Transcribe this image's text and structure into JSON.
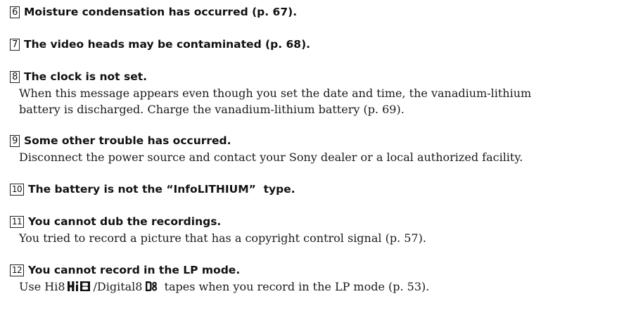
{
  "messages": [
    {
      "number": "6",
      "title": "Moisture condensation has occurred (p. 67).",
      "body": []
    },
    {
      "number": "7",
      "title": "The video heads may be contaminated (p. 68).",
      "body": []
    },
    {
      "number": "8",
      "title": "The clock is not set.",
      "body": [
        "When this message appears even though you set the date and time, the vanadium-lithium",
        "battery is discharged. Charge the vanadium-lithium battery (p. 69)."
      ]
    },
    {
      "number": "9",
      "title": "Some other trouble has occurred.",
      "body": [
        "Disconnect the power source and contact your Sony dealer or a local authorized facility."
      ]
    },
    {
      "number": "10",
      "title": "The battery is not the “InfoLITHIUM”  type.",
      "body": []
    },
    {
      "number": "11",
      "title": "You cannot dub the recordings.",
      "body": [
        "You tried to record a picture that has a copyright control signal (p. 57)."
      ]
    },
    {
      "number": "12",
      "title": "You cannot record in the LP mode.",
      "body_parts": {
        "before": "Use Hi8",
        "middle": "/Digital8",
        "after": "tapes when you record in the LP mode (p. 53)."
      }
    }
  ],
  "icons": {
    "hi8": "hi8-logo-icon",
    "digital8": "digital8-logo-icon"
  }
}
